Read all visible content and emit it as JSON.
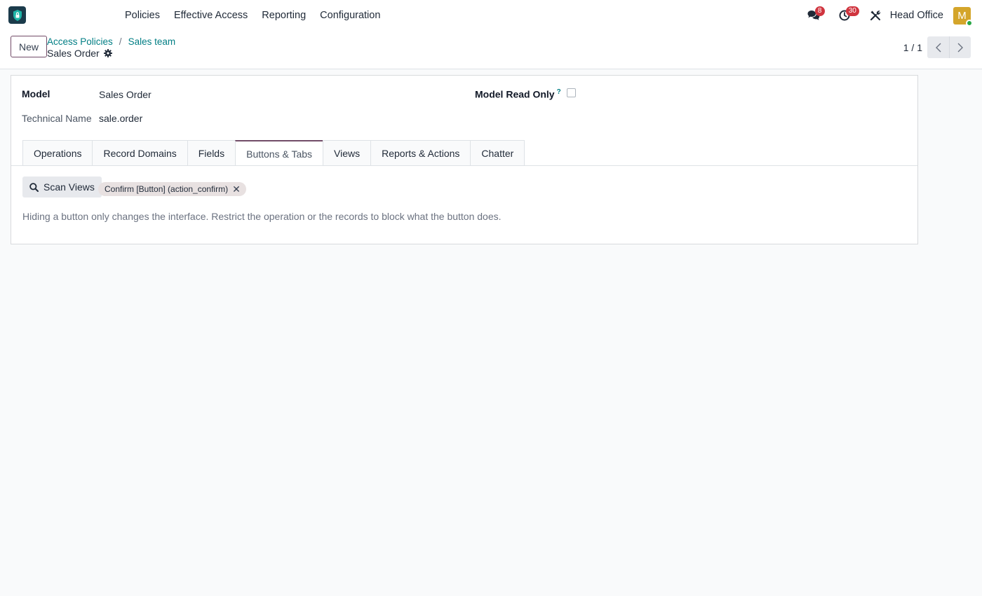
{
  "navbar": {
    "menu": [
      "Policies",
      "Effective Access",
      "Reporting",
      "Configuration"
    ],
    "messages_count": "8",
    "activities_count": "30",
    "company": "Head Office",
    "avatar_initial": "M"
  },
  "control": {
    "new_label": "New",
    "breadcrumb": [
      "Access Policies",
      "Sales team"
    ],
    "breadcrumb_sep": "/",
    "record_title": "Sales Order",
    "pager": "1 / 1"
  },
  "form": {
    "model_label": "Model",
    "model_value": "Sales Order",
    "technical_label": "Technical Name",
    "technical_value": "sale.order",
    "read_only_label": "Model Read Only",
    "read_only_help": "?",
    "read_only_checked": false
  },
  "tabs": [
    {
      "label": "Operations",
      "active": false
    },
    {
      "label": "Record Domains",
      "active": false
    },
    {
      "label": "Fields",
      "active": false
    },
    {
      "label": "Buttons & Tabs",
      "active": true
    },
    {
      "label": "Views",
      "active": false
    },
    {
      "label": "Reports & Actions",
      "active": false
    },
    {
      "label": "Chatter",
      "active": false
    }
  ],
  "buttons_tab": {
    "scan_label": "Scan Views",
    "tag_label": "Confirm [Button] (action_confirm)",
    "tag_remove": "✕",
    "hint": "Hiding a button only changes the interface. Restrict the operation or the records to block what the button does."
  },
  "colors": {
    "brand": "#714b67",
    "link": "#017e84",
    "badge": "#d0353f",
    "avatar": "#d4a52a"
  }
}
